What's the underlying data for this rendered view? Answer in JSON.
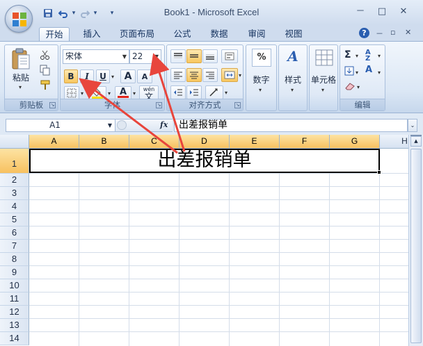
{
  "window": {
    "title": "Book1 - Microsoft Excel",
    "minimize": "－",
    "maximize": "□",
    "close": "✕"
  },
  "quick_access": {
    "undo_arrow": "▾",
    "redo_arrow": "▾",
    "customize": "▾"
  },
  "tabs": [
    "开始",
    "插入",
    "页面布局",
    "公式",
    "数据",
    "审阅",
    "视图"
  ],
  "ribbon": {
    "clipboard": {
      "paste_label": "粘贴",
      "group_label": "剪贴板"
    },
    "font": {
      "font_name": "宋体",
      "font_size": "22",
      "bold": "B",
      "italic": "I",
      "underline": "U",
      "grow": "A",
      "shrink": "A",
      "font_color_glyph": "A",
      "wen_top": "wén",
      "wen_char": "文",
      "group_label": "字体"
    },
    "alignment": {
      "group_label": "对齐方式"
    },
    "number": {
      "percent": "%",
      "label": "数字"
    },
    "styles": {
      "glyph": "A",
      "label": "样式"
    },
    "cells": {
      "label": "单元格"
    },
    "editing": {
      "sigma": "Σ",
      "az": "A Z",
      "find": "A",
      "group_label": "编辑"
    }
  },
  "formula_bar": {
    "name_box": "A1",
    "fx": "fx",
    "content": "出差报销单"
  },
  "sheet": {
    "columns": [
      "A",
      "B",
      "C",
      "D",
      "E",
      "F",
      "G",
      "H"
    ],
    "rows": [
      "1",
      "2",
      "3",
      "4",
      "5",
      "6",
      "7",
      "8",
      "9",
      "10",
      "11",
      "12",
      "13",
      "14"
    ],
    "a1_value": "出差报销单"
  },
  "colors": {
    "selection_header": "#f7c160",
    "annotation_arrow": "#e8453c"
  }
}
